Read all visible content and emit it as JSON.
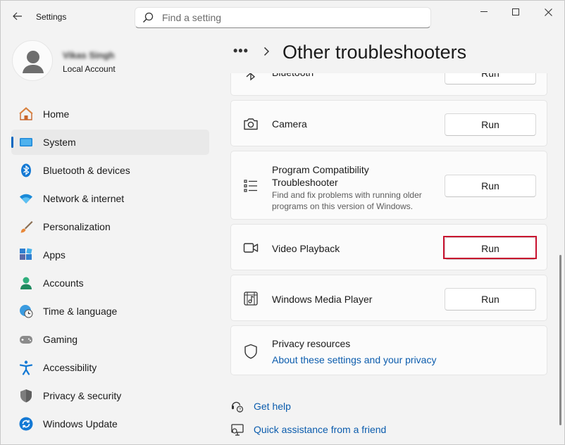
{
  "window": {
    "app_title": "Settings",
    "search_placeholder": "Find a setting"
  },
  "account": {
    "name": "Vikas Singh",
    "type": "Local Account"
  },
  "sidebar": {
    "selected": "System",
    "items": [
      {
        "label": "Home",
        "icon": "home-icon"
      },
      {
        "label": "System",
        "icon": "system-display-icon"
      },
      {
        "label": "Bluetooth & devices",
        "icon": "bluetooth-icon"
      },
      {
        "label": "Network & internet",
        "icon": "wifi-icon"
      },
      {
        "label": "Personalization",
        "icon": "brush-icon"
      },
      {
        "label": "Apps",
        "icon": "apps-icon"
      },
      {
        "label": "Accounts",
        "icon": "accounts-icon"
      },
      {
        "label": "Time & language",
        "icon": "globe-clock-icon"
      },
      {
        "label": "Gaming",
        "icon": "gamepad-icon"
      },
      {
        "label": "Accessibility",
        "icon": "accessibility-icon"
      },
      {
        "label": "Privacy & security",
        "icon": "shield-icon"
      },
      {
        "label": "Windows Update",
        "icon": "update-icon"
      }
    ]
  },
  "main": {
    "breadcrumb_more": "•••",
    "title": "Other troubleshooters",
    "troubleshooters": [
      {
        "title": "Bluetooth",
        "button": "Run",
        "icon": "bluetooth-icon"
      },
      {
        "title": "Camera",
        "button": "Run",
        "icon": "camera-icon"
      },
      {
        "title": "Program Compatibility Troubleshooter",
        "description": "Find and fix problems with running older programs on this version of Windows.",
        "button": "Run",
        "icon": "list-icon"
      },
      {
        "title": "Video Playback",
        "button": "Run",
        "icon": "video-icon",
        "highlighted": true
      },
      {
        "title": "Windows Media Player",
        "button": "Run",
        "icon": "media-player-icon"
      }
    ],
    "privacy": {
      "title": "Privacy resources",
      "link": "About these settings and your privacy",
      "icon": "shield-icon"
    },
    "help_links": [
      {
        "label": "Get help",
        "icon": "help-icon"
      },
      {
        "label": "Quick assistance from a friend",
        "icon": "remote-assist-icon"
      }
    ]
  },
  "colors": {
    "accent": "#0067c0",
    "link": "#0b5cad",
    "highlight": "#c8102e"
  }
}
